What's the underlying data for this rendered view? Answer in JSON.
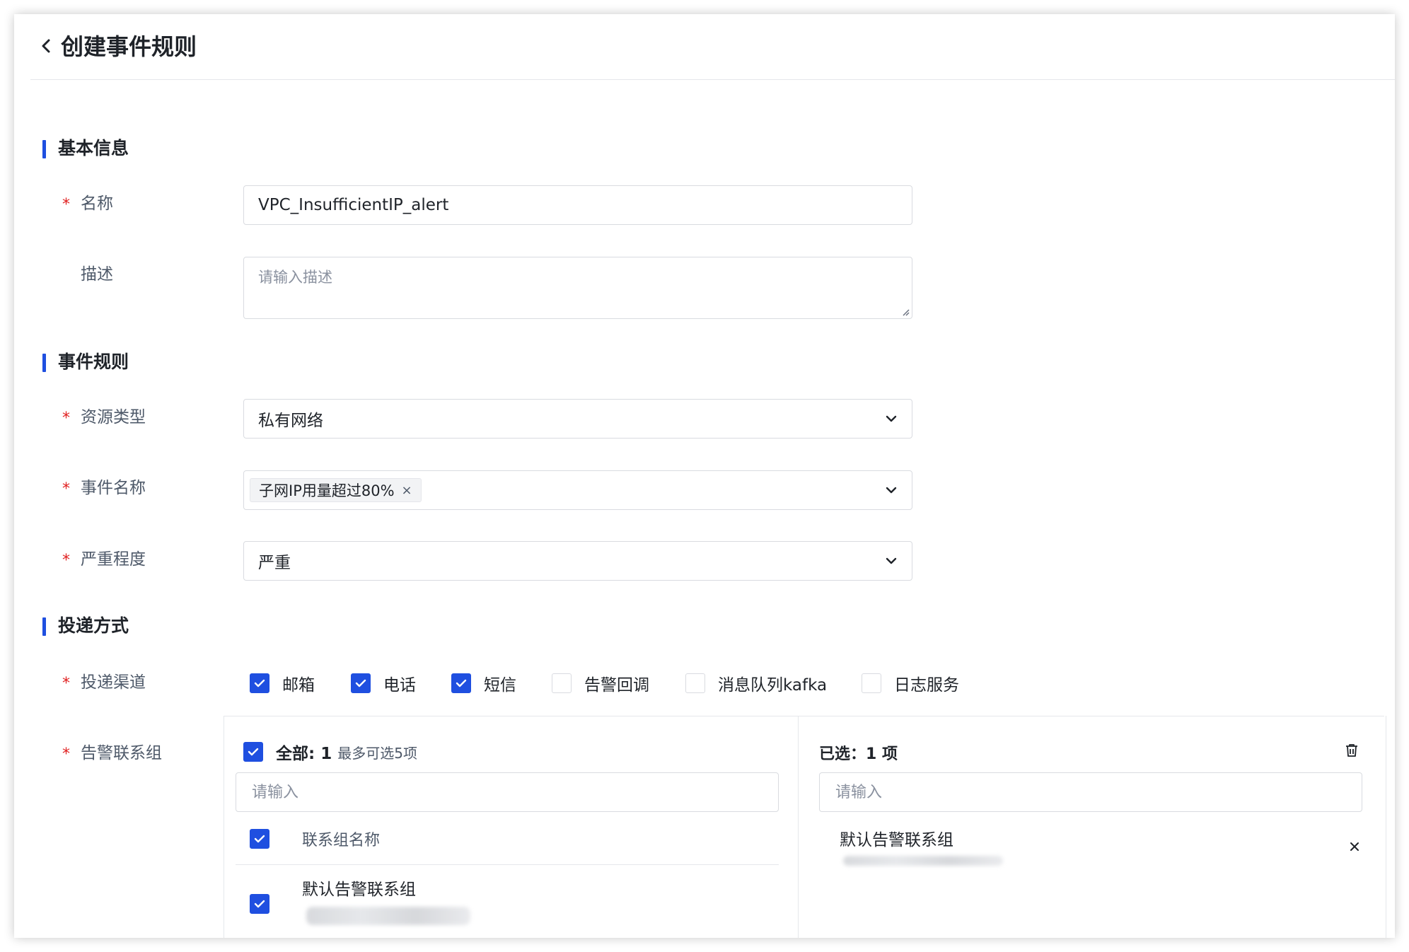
{
  "header": {
    "title": "创建事件规则"
  },
  "sections": {
    "basic": "基本信息",
    "rules": "事件规则",
    "delivery": "投递方式"
  },
  "required_mark": "*",
  "form": {
    "name": {
      "label": "名称",
      "value": "VPC_InsufficientIP_alert"
    },
    "description": {
      "label": "描述",
      "placeholder": "请输入描述"
    },
    "resource_type": {
      "label": "资源类型",
      "value": "私有网络"
    },
    "event_name": {
      "label": "事件名称",
      "tags": [
        "子网IP用量超过80%"
      ]
    },
    "severity": {
      "label": "严重程度",
      "value": "严重"
    },
    "channels": {
      "label": "投递渠道",
      "options": [
        {
          "label": "邮箱",
          "checked": true
        },
        {
          "label": "电话",
          "checked": true
        },
        {
          "label": "短信",
          "checked": true
        },
        {
          "label": "告警回调",
          "checked": false
        },
        {
          "label": "消息队列kafka",
          "checked": false
        },
        {
          "label": "日志服务",
          "checked": false
        }
      ]
    },
    "contact_groups": {
      "label": "告警联系组",
      "left": {
        "all_label": "全部: 1",
        "limit_hint": "最多可选5项",
        "search_placeholder": "请输入",
        "column_header": "联系组名称",
        "items": [
          {
            "name": "默认告警联系组",
            "checked": true
          }
        ]
      },
      "right": {
        "selected_label": "已选：1 项",
        "search_placeholder": "请输入",
        "items": [
          {
            "name": "默认告警联系组"
          }
        ]
      }
    }
  },
  "colors": {
    "accent": "#1f4fe0",
    "required": "#e02020",
    "border": "#d9dbe0"
  },
  "icons": [
    "back-chevron-icon",
    "chevron-down-icon",
    "check-icon",
    "trash-icon",
    "close-icon",
    "tag-close-icon",
    "resize-handle-icon"
  ]
}
